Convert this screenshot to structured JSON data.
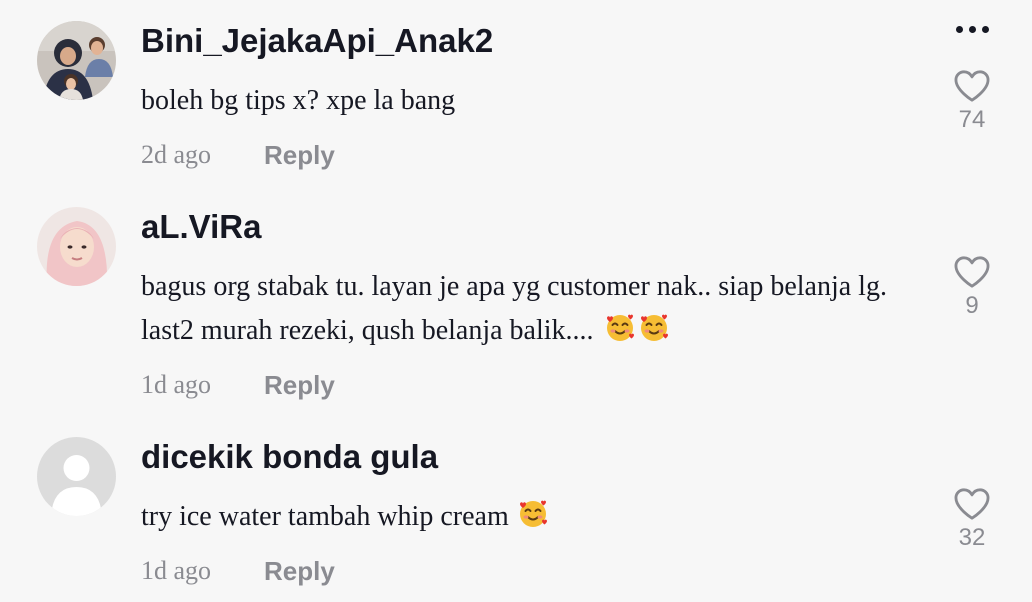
{
  "icons": {
    "more": "more-horizontal-icon",
    "like": "heart-outline-icon",
    "emoji": "smiling-face-with-hearts-icon"
  },
  "colors": {
    "background": "#f7f7f7",
    "primary_text": "#161823",
    "secondary_text": "#8a8b91",
    "emoji_face": "#f6bd34",
    "emoji_heart": "#e8352d"
  },
  "comments": [
    {
      "username": "Bini_JejakaApi_Anak2",
      "text": "boleh bg tips x? xpe la bang",
      "emoji_count": 0,
      "time": "2d ago",
      "reply_label": "Reply",
      "likes": "74"
    },
    {
      "username": "aL.ViRa",
      "text": "bagus org stabak tu. layan je apa yg customer nak.. siap belanja lg. last2 murah rezeki, qush belanja balik....",
      "emoji_count": 2,
      "time": "1d ago",
      "reply_label": "Reply",
      "likes": "9"
    },
    {
      "username": "dicekik bonda gula",
      "text": "try ice water tambah whip cream",
      "emoji_count": 1,
      "time": "1d ago",
      "reply_label": "Reply",
      "likes": "32"
    }
  ]
}
